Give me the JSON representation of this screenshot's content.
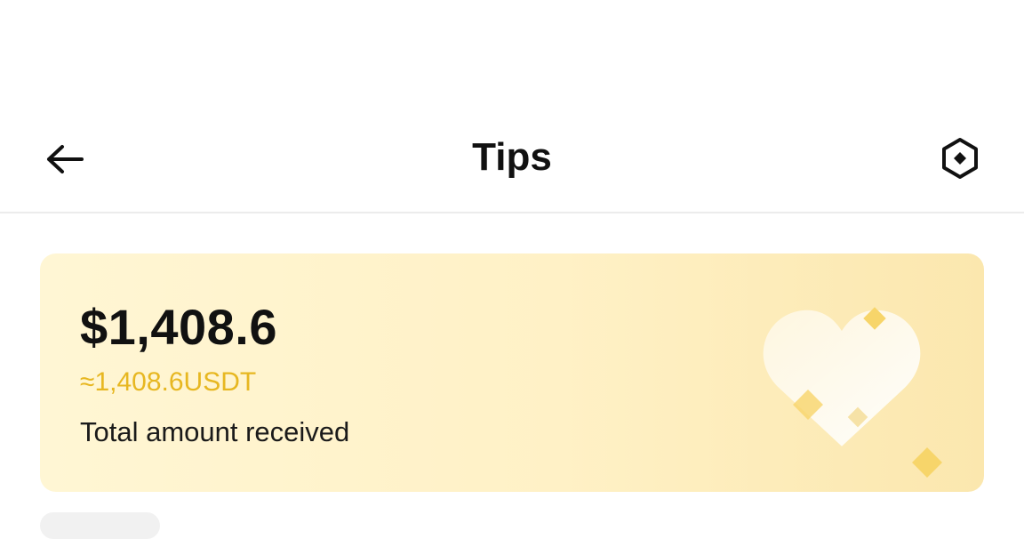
{
  "header": {
    "title": "Tips",
    "back_icon": "arrow-left-icon",
    "settings_icon": "hexagon-settings-icon"
  },
  "summary": {
    "amount": "$1,408.6",
    "usdt": "≈1,408.6USDT",
    "caption": "Total amount received"
  },
  "colors": {
    "accent": "#e7b721",
    "card_start": "#fff6d4",
    "card_end": "#fbe7ae",
    "divider": "#ececec"
  }
}
